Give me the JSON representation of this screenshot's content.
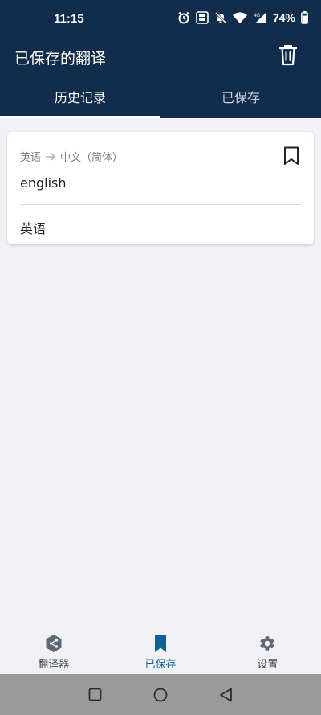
{
  "status_bar": {
    "time": "11:15",
    "battery": "74%",
    "network": "4G"
  },
  "app_bar": {
    "title": "已保存的翻译"
  },
  "tabs": [
    {
      "label": "历史记录",
      "active": true
    },
    {
      "label": "已保存",
      "active": false
    }
  ],
  "history": [
    {
      "source_lang": "英语",
      "target_lang": "中文（简体）",
      "source_text": "english",
      "translation": "英语"
    }
  ],
  "bottom_nav": [
    {
      "label": "翻译器",
      "icon": "translator-icon",
      "active": false
    },
    {
      "label": "已保存",
      "icon": "bookmark-icon",
      "active": true
    },
    {
      "label": "设置",
      "icon": "gear-icon",
      "active": false
    }
  ],
  "colors": {
    "header": "#122c4c",
    "background": "#f1f1f5",
    "accent": "#0f6394"
  }
}
